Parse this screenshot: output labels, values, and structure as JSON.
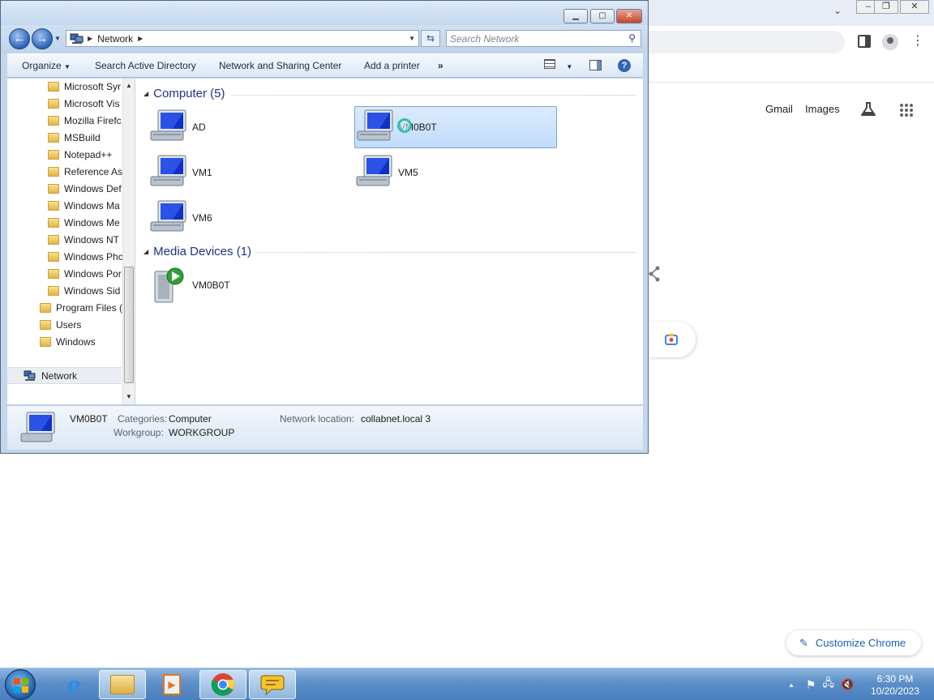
{
  "explorer": {
    "breadcrumb": [
      "Network"
    ],
    "search_placeholder": "Search Network",
    "commands": {
      "organize": "Organize",
      "search_ad": "Search Active Directory",
      "network_sharing": "Network and Sharing Center",
      "add_printer": "Add a printer",
      "more": "»"
    },
    "nav_items": [
      "Microsoft Syr",
      "Microsoft Vis",
      "Mozilla Firefc",
      "MSBuild",
      "Notepad++",
      "Reference As",
      "Windows Def",
      "Windows Ma",
      "Windows Me",
      "Windows NT",
      "Windows Phc",
      "Windows Por",
      "Windows Sid",
      "Program Files (",
      "Users",
      "Windows"
    ],
    "network_label": "Network",
    "groups": [
      {
        "header": "Computer (5)",
        "items": [
          "AD",
          "VM0B0T",
          "VM1",
          "VM5",
          "VM6"
        ],
        "selected": "VM0B0T"
      },
      {
        "header": "Media Devices (1)",
        "items": [
          "VM0B0T"
        ]
      }
    ],
    "details": {
      "name": "VM0B0T",
      "categories_label": "Categories:",
      "categories_value": "Computer",
      "workgroup_label": "Workgroup:",
      "workgroup_value": "WORKGROUP",
      "location_label": "Network location:",
      "location_value": "collabnet.local  3"
    }
  },
  "chrome": {
    "gmail": "Gmail",
    "images": "Images",
    "customize": "Customize Chrome"
  },
  "taskbar": {
    "time": "6:30 PM",
    "date": "10/20/2023"
  },
  "colors": {
    "accent": "#1e3287",
    "selection": "#c1dcfc",
    "taskbar": "#5d8fc8"
  }
}
